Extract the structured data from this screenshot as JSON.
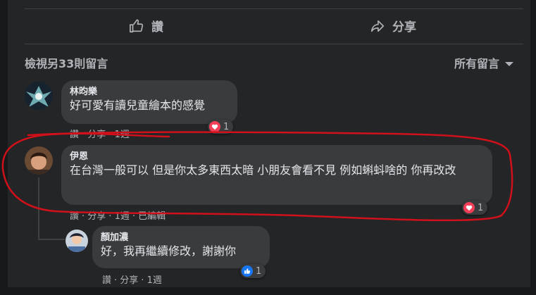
{
  "actions": {
    "like_label": "讚",
    "share_label": "分享"
  },
  "comments_header": {
    "more_comments": "檢視另33則留言",
    "filter_label": "所有留言"
  },
  "comments": [
    {
      "author": "林昀樂",
      "text": "好可愛有讀兒童繪本的感覺",
      "meta": {
        "like": "讚",
        "share": "分享",
        "time": "1週",
        "edited": ""
      },
      "reaction": {
        "type": "love",
        "count": "1"
      }
    },
    {
      "author": "伊恩",
      "text": "在台灣一般可以 但是你太多東西太暗 小朋友會看不見 例如蝌蚪啥的 你再改改",
      "meta": {
        "like": "讚",
        "share": "分享",
        "time": "1週",
        "edited": "已編輯"
      },
      "reaction": {
        "type": "love",
        "count": "1"
      }
    },
    {
      "author": "顏加濃",
      "text": "好，我再繼續修改，謝謝你",
      "meta": {
        "like": "讚",
        "share": "分享",
        "time": "1週",
        "edited": ""
      },
      "reaction": {
        "type": "like",
        "count": "1"
      }
    }
  ],
  "annotation_color": "#d0101a",
  "colors": {
    "love": "#f33e58",
    "like": "#1877f2"
  }
}
